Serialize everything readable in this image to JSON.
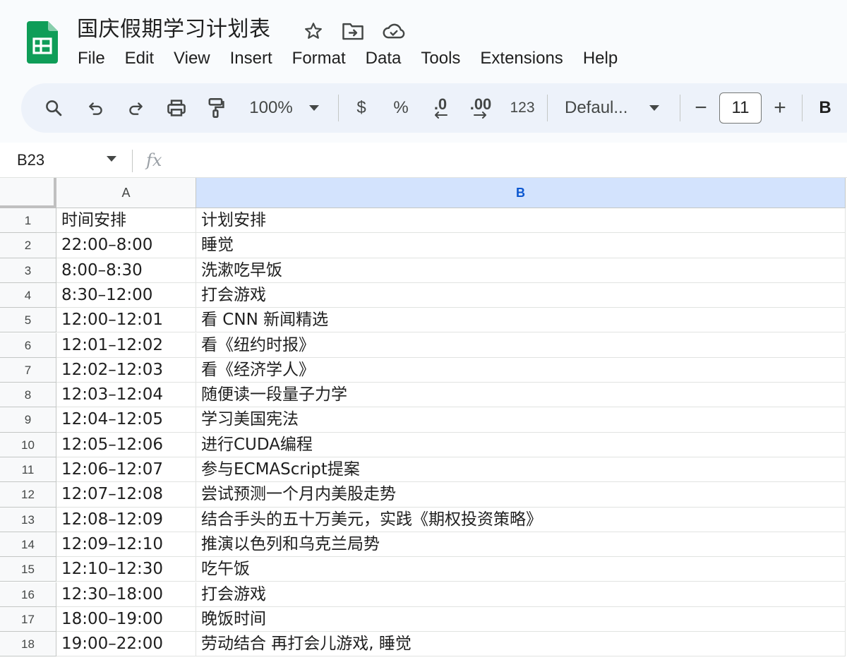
{
  "app": {
    "title": "国庆假期学习计划表",
    "icons": [
      "star-icon",
      "move-to-folder-icon",
      "cloud-saved-icon"
    ],
    "brand_color": "#0f9d58"
  },
  "menu": [
    "File",
    "Edit",
    "View",
    "Insert",
    "Format",
    "Data",
    "Tools",
    "Extensions",
    "Help"
  ],
  "toolbar": {
    "zoom": "100%",
    "currency": "$",
    "percent": "%",
    "decrease_decimal": ".0",
    "increase_decimal": ".00",
    "number_format": "123",
    "font": "Defaul...",
    "font_size": "11",
    "minus": "−",
    "plus": "+",
    "bold": "B"
  },
  "formula_bar": {
    "cell_ref": "B23",
    "fx": "fx",
    "value": ""
  },
  "columns": [
    "A",
    "B"
  ],
  "selected_column": "B",
  "rows": [
    {
      "n": "1",
      "a": "时间安排",
      "b": "计划安排"
    },
    {
      "n": "2",
      "a": "22:00–8:00",
      "b": "睡觉"
    },
    {
      "n": "3",
      "a": "8:00–8:30",
      "b": "洗漱吃早饭"
    },
    {
      "n": "4",
      "a": "8:30–12:00",
      "b": "打会游戏"
    },
    {
      "n": "5",
      "a": "12:00–12:01",
      "b": "看 CNN 新闻精选"
    },
    {
      "n": "6",
      "a": "12:01–12:02",
      "b": "看《纽约时报》"
    },
    {
      "n": "7",
      "a": "12:02–12:03",
      "b": "看《经济学人》"
    },
    {
      "n": "8",
      "a": "12:03–12:04",
      "b": "随便读一段量子力学"
    },
    {
      "n": "9",
      "a": "12:04–12:05",
      "b": "学习美国宪法"
    },
    {
      "n": "10",
      "a": "12:05–12:06",
      "b": "进行CUDA编程"
    },
    {
      "n": "11",
      "a": "12:06–12:07",
      "b": "参与ECMAScript提案"
    },
    {
      "n": "12",
      "a": "12:07–12:08",
      "b": "尝试预测一个月内美股走势"
    },
    {
      "n": "13",
      "a": "12:08–12:09",
      "b": "结合手头的五十万美元，实践《期权投资策略》"
    },
    {
      "n": "14",
      "a": "12:09–12:10",
      "b": "推演以色列和乌克兰局势"
    },
    {
      "n": "15",
      "a": "12:10–12:30",
      "b": "吃午饭"
    },
    {
      "n": "16",
      "a": "12:30–18:00",
      "b": "打会游戏"
    },
    {
      "n": "17",
      "a": "18:00–19:00",
      "b": "晚饭时间"
    },
    {
      "n": "18",
      "a": "19:00–22:00",
      "b": "劳动结合 再打会儿游戏, 睡觉"
    }
  ]
}
